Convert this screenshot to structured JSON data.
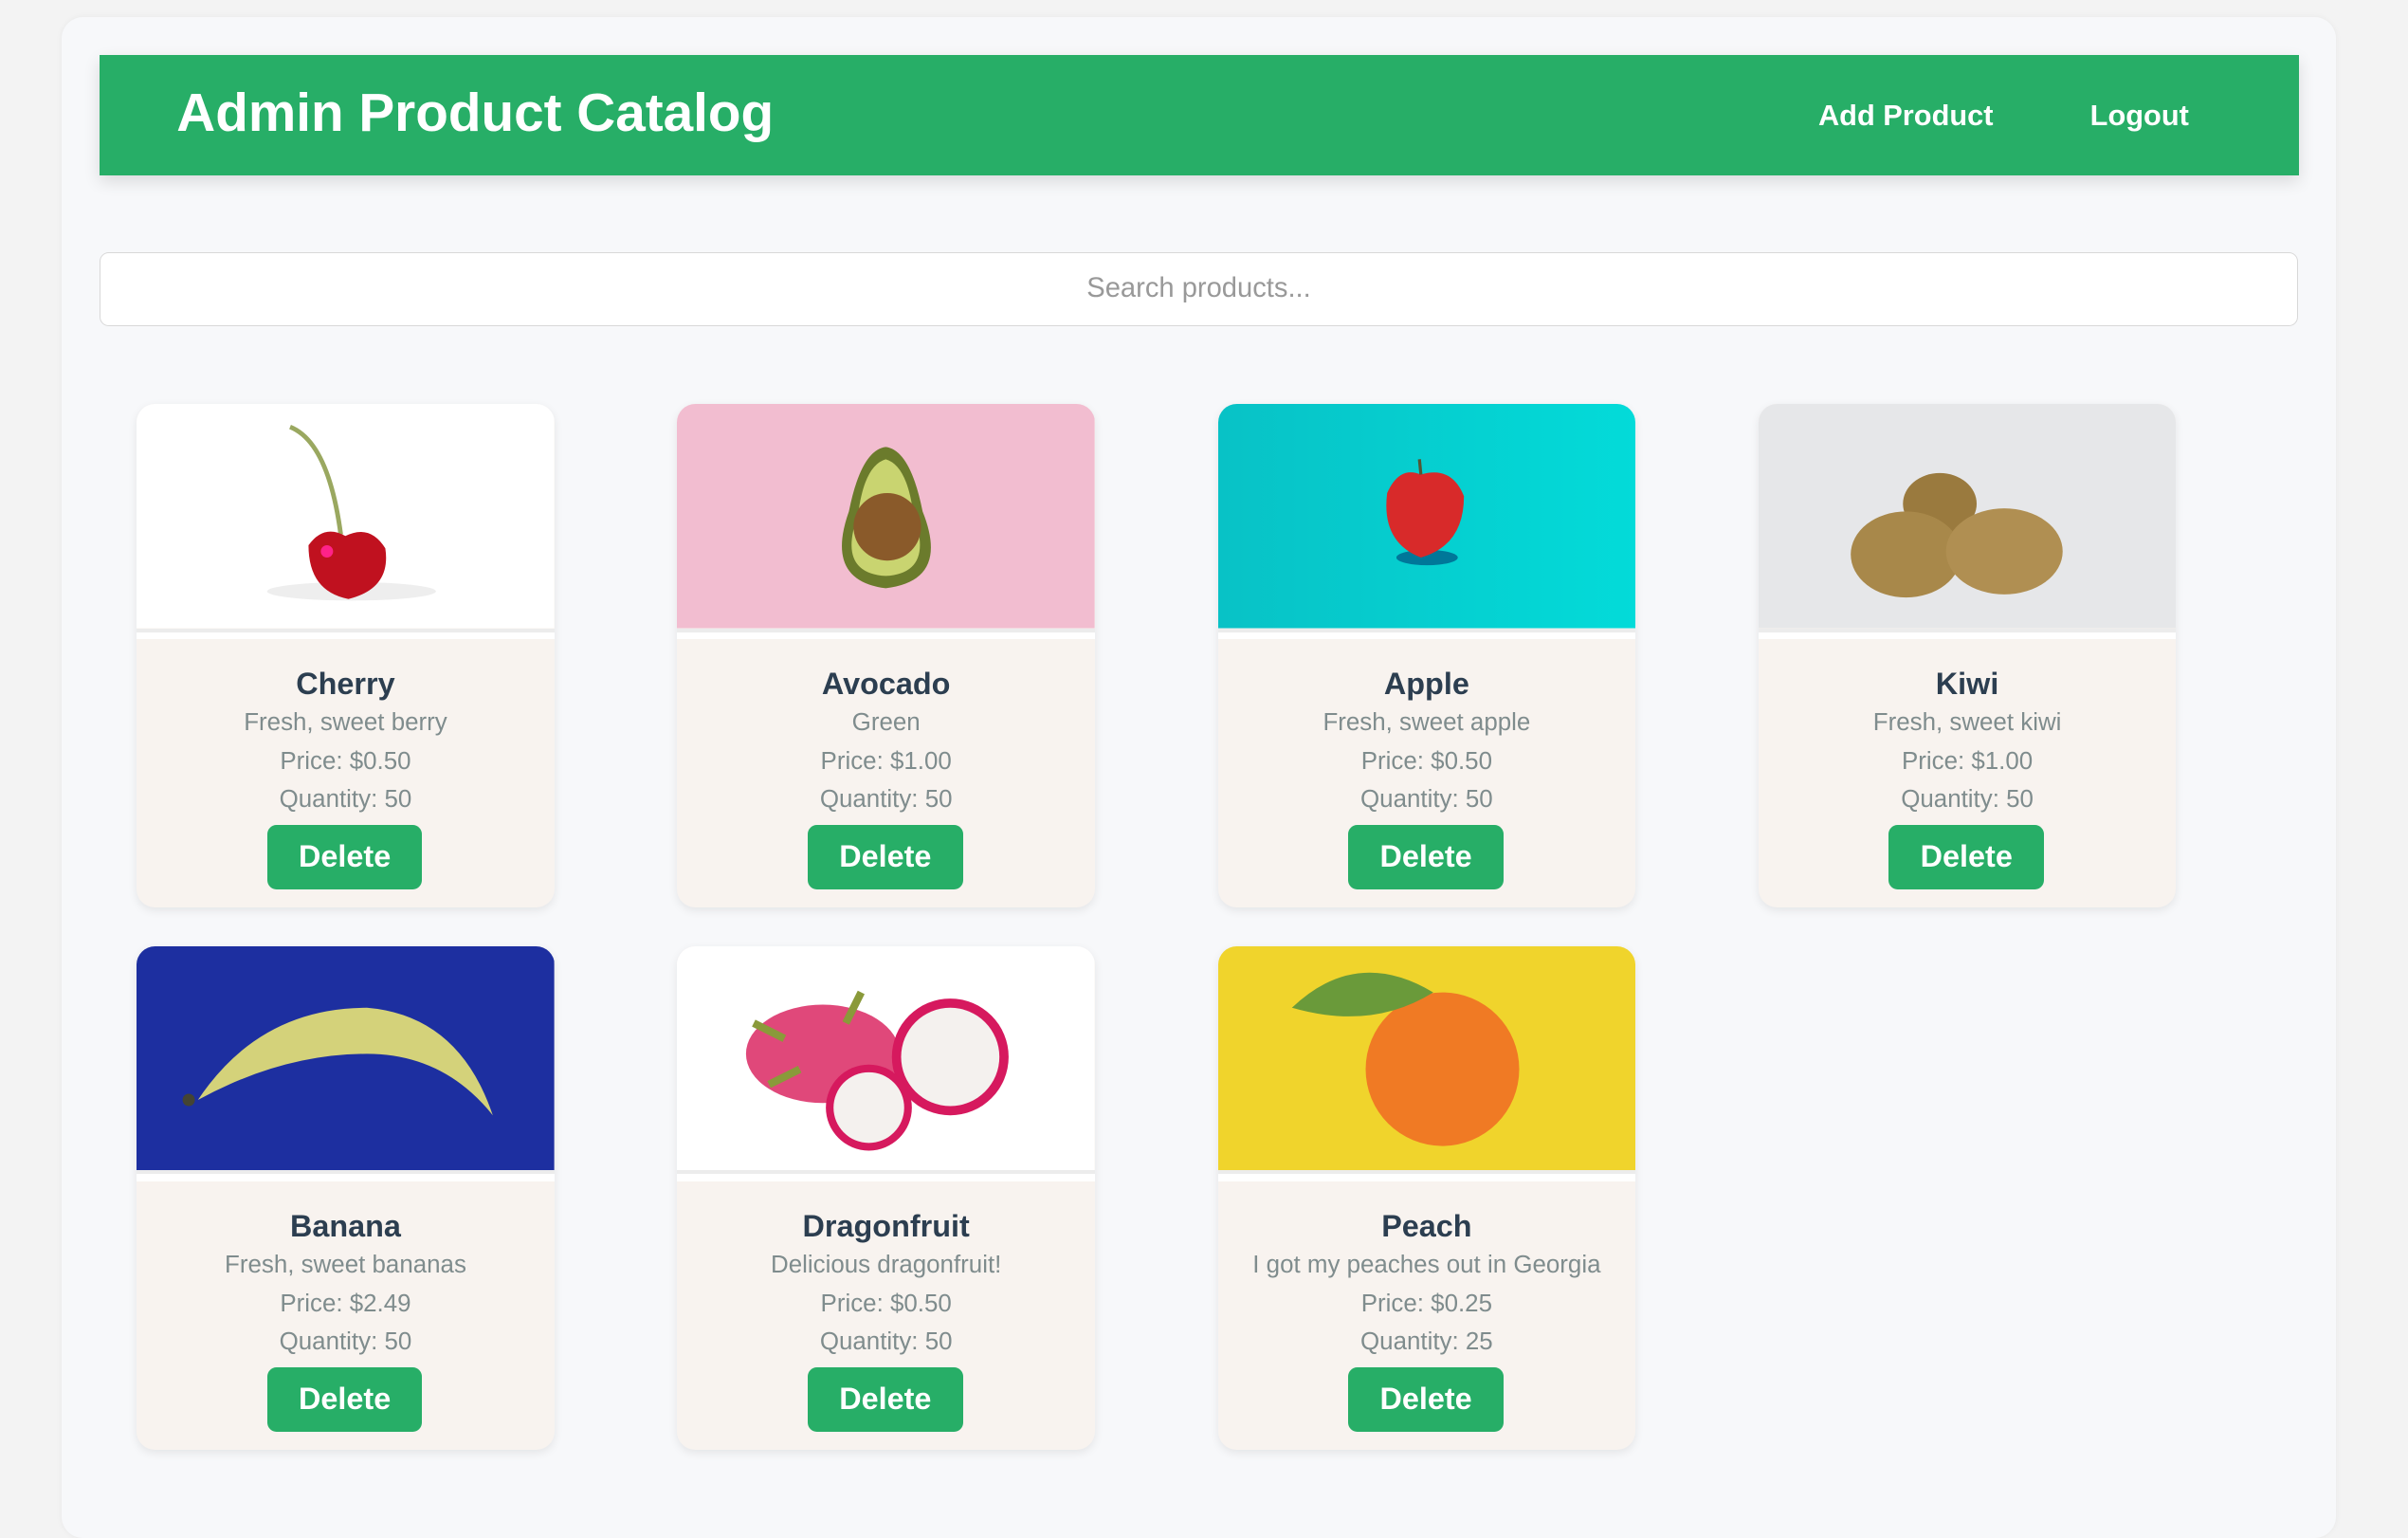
{
  "header": {
    "title": "Admin Product Catalog",
    "add_product": "Add Product",
    "logout": "Logout"
  },
  "search": {
    "placeholder": "Search products...",
    "value": ""
  },
  "colors": {
    "accent": "#27ae67"
  },
  "products": [
    {
      "name": "Cherry",
      "description": "Fresh, sweet berry",
      "price": "Price: $0.50",
      "quantity": "Quantity: 50",
      "delete": "Delete",
      "image": "cherry-image"
    },
    {
      "name": "Avocado",
      "description": "Green",
      "price": "Price: $1.00",
      "quantity": "Quantity: 50",
      "delete": "Delete",
      "image": "avocado-image"
    },
    {
      "name": "Apple",
      "description": "Fresh, sweet apple",
      "price": "Price: $0.50",
      "quantity": "Quantity: 50",
      "delete": "Delete",
      "image": "apple-image"
    },
    {
      "name": "Kiwi",
      "description": "Fresh, sweet kiwi",
      "price": "Price: $1.00",
      "quantity": "Quantity: 50",
      "delete": "Delete",
      "image": "kiwi-image"
    },
    {
      "name": "Banana",
      "description": "Fresh, sweet bananas",
      "price": "Price: $2.49",
      "quantity": "Quantity: 50",
      "delete": "Delete",
      "image": "banana-image"
    },
    {
      "name": "Dragonfruit",
      "description": "Delicious dragonfruit!",
      "price": "Price: $0.50",
      "quantity": "Quantity: 50",
      "delete": "Delete",
      "image": "dragonfruit-image"
    },
    {
      "name": "Peach",
      "description": "I got my peaches out in Georgia",
      "price": "Price: $0.25",
      "quantity": "Quantity: 25",
      "delete": "Delete",
      "image": "peach-image"
    }
  ]
}
